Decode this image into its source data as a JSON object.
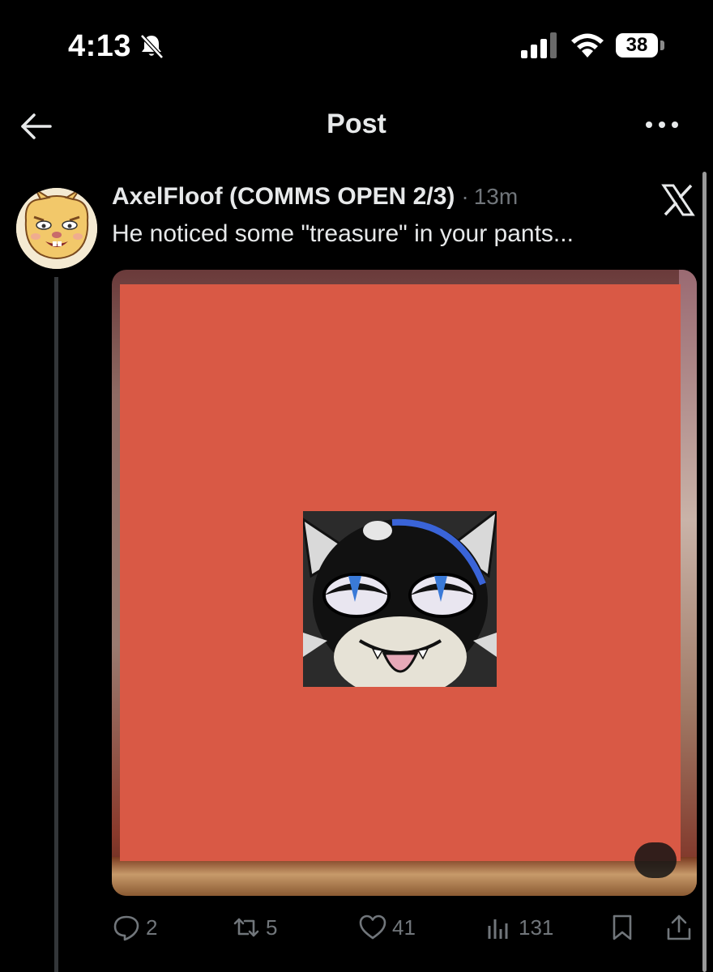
{
  "status_bar": {
    "time": "4:13",
    "battery_level": "38",
    "icons": [
      "bell-off-icon",
      "signal-icon",
      "wifi-icon",
      "battery-icon"
    ]
  },
  "nav": {
    "title": "Post",
    "back_icon": "arrow-left-icon",
    "more_icon": "more-horizontal-icon"
  },
  "post": {
    "author": "AxelFloof (COMMS OPEN 2/3)",
    "separator": "·",
    "time": "13m",
    "text": "He noticed some \"treasure\" in your pants...",
    "source_icon": "x-logo-icon",
    "media": {
      "redaction_color": "#d95945"
    },
    "actions": {
      "replies": "2",
      "reposts": "5",
      "likes": "41",
      "views": "131"
    }
  },
  "colors": {
    "background": "#000000",
    "text_primary": "#e7e9ea",
    "text_secondary": "#71767b"
  }
}
